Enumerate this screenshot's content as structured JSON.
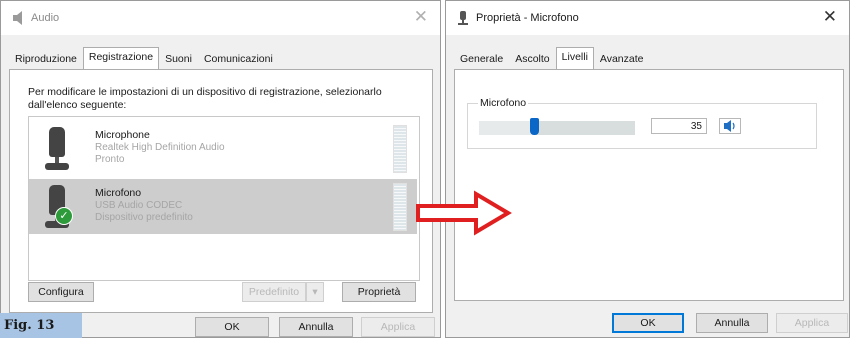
{
  "audio_window": {
    "title": "Audio",
    "close_glyph": "✕",
    "tabs": [
      {
        "label": "Riproduzione",
        "active": false
      },
      {
        "label": "Registrazione",
        "active": true
      },
      {
        "label": "Suoni",
        "active": false
      },
      {
        "label": "Comunicazioni",
        "active": false
      }
    ],
    "instructions": "Per modificare le impostazioni di un dispositivo di registrazione, selezionarlo dall'elenco seguente:",
    "devices": [
      {
        "name": "Microphone",
        "driver": "Realtek High Definition Audio",
        "status": "Pronto",
        "selected": false,
        "default": false
      },
      {
        "name": "Microfono",
        "driver": "USB Audio CODEC",
        "status": "Dispositivo predefinito",
        "selected": true,
        "default": true
      }
    ],
    "buttons": {
      "configure": "Configura",
      "set_default": "Predefinito",
      "set_default_arrow": "▾",
      "properties": "Proprietà",
      "ok": "OK",
      "cancel": "Annulla",
      "apply": "Applica"
    }
  },
  "properties_window": {
    "title": "Proprietà - Microfono",
    "close_glyph": "✕",
    "tabs": [
      {
        "label": "Generale",
        "active": false
      },
      {
        "label": "Ascolto",
        "active": false
      },
      {
        "label": "Livelli",
        "active": true
      },
      {
        "label": "Avanzate",
        "active": false
      }
    ],
    "level_group_label": "Microfono",
    "level_value": "35",
    "level_fraction": 0.35,
    "buttons": {
      "ok": "OK",
      "cancel": "Annulla",
      "apply": "Applica"
    }
  },
  "caption": "Fig. 13",
  "icons": {
    "window_icon": "speaker-icon",
    "mic_icon": "microphone-icon",
    "default_badge": "checkmark-icon",
    "arrow": "right-arrow-icon",
    "mute": "speaker-volume-icon"
  },
  "colors": {
    "accent": "#0a67c8",
    "check_green": "#2e9b3a",
    "arrow_red": "#e02020",
    "caption_bg": "#a8c4e4"
  }
}
